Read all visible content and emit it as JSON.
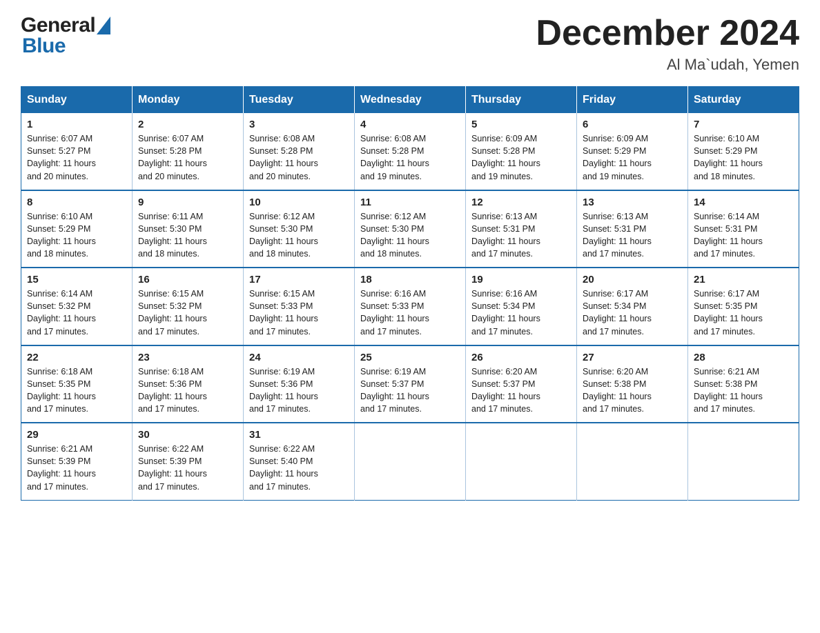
{
  "header": {
    "logo_general": "General",
    "logo_blue": "Blue",
    "month_title": "December 2024",
    "location": "Al Ma`udah, Yemen"
  },
  "weekdays": [
    "Sunday",
    "Monday",
    "Tuesday",
    "Wednesday",
    "Thursday",
    "Friday",
    "Saturday"
  ],
  "weeks": [
    [
      {
        "day": "1",
        "sunrise": "6:07 AM",
        "sunset": "5:27 PM",
        "daylight": "11 hours and 20 minutes."
      },
      {
        "day": "2",
        "sunrise": "6:07 AM",
        "sunset": "5:28 PM",
        "daylight": "11 hours and 20 minutes."
      },
      {
        "day": "3",
        "sunrise": "6:08 AM",
        "sunset": "5:28 PM",
        "daylight": "11 hours and 20 minutes."
      },
      {
        "day": "4",
        "sunrise": "6:08 AM",
        "sunset": "5:28 PM",
        "daylight": "11 hours and 19 minutes."
      },
      {
        "day": "5",
        "sunrise": "6:09 AM",
        "sunset": "5:28 PM",
        "daylight": "11 hours and 19 minutes."
      },
      {
        "day": "6",
        "sunrise": "6:09 AM",
        "sunset": "5:29 PM",
        "daylight": "11 hours and 19 minutes."
      },
      {
        "day": "7",
        "sunrise": "6:10 AM",
        "sunset": "5:29 PM",
        "daylight": "11 hours and 18 minutes."
      }
    ],
    [
      {
        "day": "8",
        "sunrise": "6:10 AM",
        "sunset": "5:29 PM",
        "daylight": "11 hours and 18 minutes."
      },
      {
        "day": "9",
        "sunrise": "6:11 AM",
        "sunset": "5:30 PM",
        "daylight": "11 hours and 18 minutes."
      },
      {
        "day": "10",
        "sunrise": "6:12 AM",
        "sunset": "5:30 PM",
        "daylight": "11 hours and 18 minutes."
      },
      {
        "day": "11",
        "sunrise": "6:12 AM",
        "sunset": "5:30 PM",
        "daylight": "11 hours and 18 minutes."
      },
      {
        "day": "12",
        "sunrise": "6:13 AM",
        "sunset": "5:31 PM",
        "daylight": "11 hours and 17 minutes."
      },
      {
        "day": "13",
        "sunrise": "6:13 AM",
        "sunset": "5:31 PM",
        "daylight": "11 hours and 17 minutes."
      },
      {
        "day": "14",
        "sunrise": "6:14 AM",
        "sunset": "5:31 PM",
        "daylight": "11 hours and 17 minutes."
      }
    ],
    [
      {
        "day": "15",
        "sunrise": "6:14 AM",
        "sunset": "5:32 PM",
        "daylight": "11 hours and 17 minutes."
      },
      {
        "day": "16",
        "sunrise": "6:15 AM",
        "sunset": "5:32 PM",
        "daylight": "11 hours and 17 minutes."
      },
      {
        "day": "17",
        "sunrise": "6:15 AM",
        "sunset": "5:33 PM",
        "daylight": "11 hours and 17 minutes."
      },
      {
        "day": "18",
        "sunrise": "6:16 AM",
        "sunset": "5:33 PM",
        "daylight": "11 hours and 17 minutes."
      },
      {
        "day": "19",
        "sunrise": "6:16 AM",
        "sunset": "5:34 PM",
        "daylight": "11 hours and 17 minutes."
      },
      {
        "day": "20",
        "sunrise": "6:17 AM",
        "sunset": "5:34 PM",
        "daylight": "11 hours and 17 minutes."
      },
      {
        "day": "21",
        "sunrise": "6:17 AM",
        "sunset": "5:35 PM",
        "daylight": "11 hours and 17 minutes."
      }
    ],
    [
      {
        "day": "22",
        "sunrise": "6:18 AM",
        "sunset": "5:35 PM",
        "daylight": "11 hours and 17 minutes."
      },
      {
        "day": "23",
        "sunrise": "6:18 AM",
        "sunset": "5:36 PM",
        "daylight": "11 hours and 17 minutes."
      },
      {
        "day": "24",
        "sunrise": "6:19 AM",
        "sunset": "5:36 PM",
        "daylight": "11 hours and 17 minutes."
      },
      {
        "day": "25",
        "sunrise": "6:19 AM",
        "sunset": "5:37 PM",
        "daylight": "11 hours and 17 minutes."
      },
      {
        "day": "26",
        "sunrise": "6:20 AM",
        "sunset": "5:37 PM",
        "daylight": "11 hours and 17 minutes."
      },
      {
        "day": "27",
        "sunrise": "6:20 AM",
        "sunset": "5:38 PM",
        "daylight": "11 hours and 17 minutes."
      },
      {
        "day": "28",
        "sunrise": "6:21 AM",
        "sunset": "5:38 PM",
        "daylight": "11 hours and 17 minutes."
      }
    ],
    [
      {
        "day": "29",
        "sunrise": "6:21 AM",
        "sunset": "5:39 PM",
        "daylight": "11 hours and 17 minutes."
      },
      {
        "day": "30",
        "sunrise": "6:22 AM",
        "sunset": "5:39 PM",
        "daylight": "11 hours and 17 minutes."
      },
      {
        "day": "31",
        "sunrise": "6:22 AM",
        "sunset": "5:40 PM",
        "daylight": "11 hours and 17 minutes."
      },
      null,
      null,
      null,
      null
    ]
  ],
  "labels": {
    "sunrise": "Sunrise:",
    "sunset": "Sunset:",
    "daylight": "Daylight:"
  }
}
